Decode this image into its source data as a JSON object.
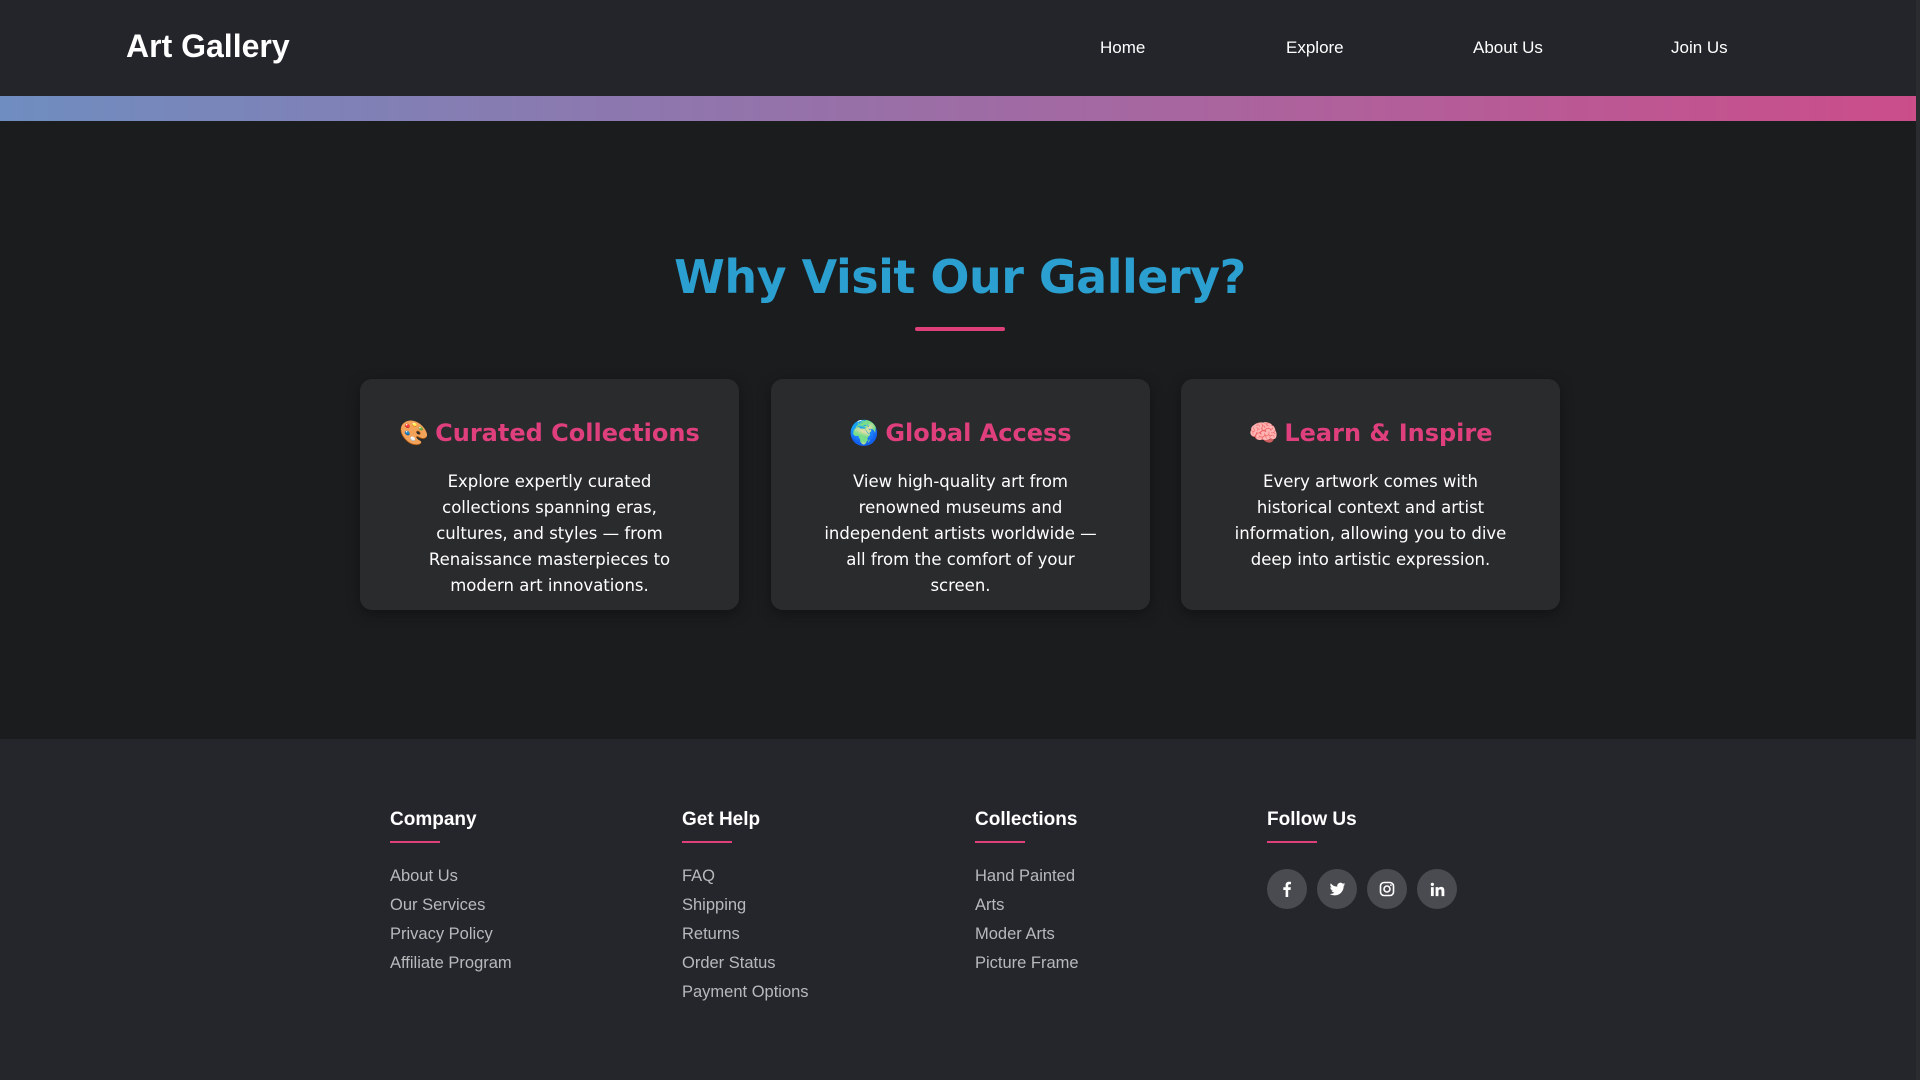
{
  "header": {
    "brand": "Art Gallery",
    "nav": [
      {
        "label": "Home"
      },
      {
        "label": "Explore"
      },
      {
        "label": "About Us"
      },
      {
        "label": "Join Us"
      }
    ]
  },
  "hero": {
    "title": "Why Visit Our Gallery?"
  },
  "features": [
    {
      "icon": "🎨",
      "icon_name": "palette-icon",
      "title": "Curated Collections",
      "text": "Explore expertly curated collections spanning eras, cultures, and styles — from Renaissance masterpieces to modern art innovations."
    },
    {
      "icon": "🌍",
      "icon_name": "globe-icon",
      "title": "Global Access",
      "text": "View high-quality art from renowned museums and independent artists worldwide — all from the comfort of your screen."
    },
    {
      "icon": "🧠",
      "icon_name": "brain-icon",
      "title": "Learn & Inspire",
      "text": "Every artwork comes with historical context and artist information, allowing you to dive deep into artistic expression."
    }
  ],
  "footer": {
    "columns": [
      {
        "heading": "Company",
        "links": [
          "About Us",
          "Our Services",
          "Privacy Policy",
          "Affiliate Program"
        ]
      },
      {
        "heading": "Get Help",
        "links": [
          "FAQ",
          "Shipping",
          "Returns",
          "Order Status",
          "Payment Options"
        ]
      },
      {
        "heading": "Collections",
        "links": [
          "Hand Painted",
          "Arts",
          "Moder Arts",
          "Picture Frame"
        ]
      }
    ],
    "follow": {
      "heading": "Follow Us",
      "socials": [
        "facebook-icon",
        "twitter-icon",
        "instagram-icon",
        "linkedin-icon"
      ]
    }
  },
  "colors": {
    "accent_pink": "#e0407a",
    "title_blue": "#2a9fd0",
    "navbar_bg": "#23252a",
    "page_bg": "#1b1c1e",
    "card_bg": "#2a2b2d"
  }
}
